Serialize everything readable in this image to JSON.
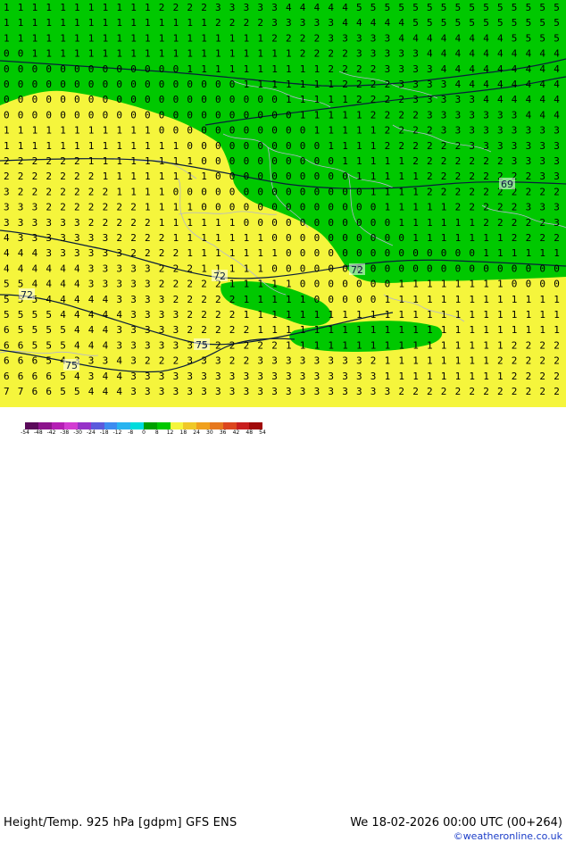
{
  "map": {
    "fields": {
      "green_color": "#00c800",
      "yellow_color": "#f5f53c",
      "border_color": "#b4b4d2",
      "contour_color": "#0a1e3c"
    },
    "contour_labels": [
      "69",
      "72",
      "72",
      "72",
      "75",
      "75"
    ],
    "grid_rows": [
      "1 1 1 1 1 1 1 1 1 1 1 2 2 2 2 3 3 3 3 3 4 4 4 4 4 5 5 5 5 5 5 5 5 5 5 5 5 5 5 5",
      "1 1 1 1 1 1 1 1 1 1 1 1 1 1 1 2 2 2 2 3 3 3 3 3 4 4 4 4 4 5 5 5 5 5 5 5 5 5 5 5",
      "1 1 1 1 1 1 1 1 1 1 1 1 1 1 1 1 1 1 1 2 2 2 2 3 3 3 3 3 4 4 4 4 4 4 4 4 5 5 5 5",
      "0 0 1 1 1 1 1 1 1 1 1 1 1 1 1 1 1 1 1 1 1 2 2 2 2 3 3 3 3 3 4 4 4 4 4 4 4 4 4 4",
      "0 0 0 0 0 0 0 0 0 0 0 0 0 1 1 1 1 1 1 1 1 1 1 2 2 2 2 3 3 3 3 4 4 4 4 4 4 4 4 4",
      "0 0 0 0 0 0 0 0 0 0 0 0 0 0 0 0 0 1 1 1 1 1 1 1 2 2 2 2 3 3 3 3 4 4 4 4 4 4 4 4",
      "0 0 0 0 0 0 0 0 0 0 0 0 0 0 0 0 0 0 0 0 1 1 1 1 1 2 2 2 2 3 3 3 3 3 4 4 4 4 4 4",
      "0 0 0 0 0 0 0 0 0 0 0 0 0 0 0 0 0 0 0 0 0 1 1 1 1 1 2 2 2 2 3 3 3 3 3 3 3 4 4 4",
      "1 1 1 1 1 1 1 1 1 1 1 0 0 0 0 0 0 0 0 0 0 0 1 1 1 1 1 2 2 2 2 3 3 3 3 3 3 3 3 3",
      "1 1 1 1 1 1 1 1 1 1 1 1 1 0 0 0 0 0 0 0 0 0 0 1 1 1 1 2 2 2 2 2 2 3 3 3 3 3 3 3",
      "2 2 2 2 2 2 1 1 1 1 1 1 1 1 0 0 0 0 0 0 0 0 0 0 1 1 1 1 1 2 2 2 2 2 2 2 3 3 3 3",
      "2 2 2 2 2 2 2 1 1 1 1 1 1 1 1 0 0 0 0 0 0 0 0 0 0 1 1 1 1 1 2 2 2 2 2 2 2 2 3 3",
      "3 2 2 2 2 2 2 2 1 1 1 1 0 0 0 0 0 0 0 0 0 0 0 0 0 0 1 1 1 1 2 2 2 2 2 2 2 2 2 2",
      "3 3 3 2 2 2 2 2 2 2 1 1 1 1 0 0 0 0 0 0 0 0 0 0 0 0 0 1 1 1 1 1 2 2 2 2 2 3 3 3",
      "3 3 3 3 3 3 2 2 2 2 2 1 1 1 1 1 1 0 0 0 0 0 0 0 0 0 0 0 1 1 1 1 1 1 2 2 2 2 2 3",
      "4 3 3 3 3 3 3 3 2 2 2 2 1 1 1 1 1 1 1 0 0 0 0 0 0 0 0 0 0 1 1 1 1 1 1 1 2 2 2 2",
      "4 4 4 3 3 3 3 3 3 2 2 2 2 1 1 1 1 1 1 1 0 0 0 0 0 0 0 0 0 0 0 0 0 0 1 1 1 1 1 1",
      "4 4 4 4 4 4 3 3 3 3 3 2 2 2 1 1 1 1 1 0 0 0 0 0 0 0 0 0 0 0 0 0 0 0 0 0 0 0 0 0",
      "5 5 4 4 4 4 3 3 3 3 3 2 2 2 2 2 1 1 1 1 1 0 0 0 0 0 0 0 1 1 1 1 1 1 1 1 0 0 0 0",
      "5 5 5 4 4 4 4 4 3 3 3 3 2 2 2 2 2 1 1 1 1 1 0 0 0 0 0 1 1 1 1 1 1 1 1 1 1 1 1 1",
      "5 5 5 5 4 4 4 4 4 3 3 3 3 2 2 2 2 1 1 1 1 1 1 1 1 1 1 1 1 1 1 1 1 1 1 1 1 1 1 1",
      "6 5 5 5 5 4 4 4 3 3 3 3 3 2 2 2 2 2 1 1 1 1 1 1 1 1 1 1 1 1 1 1 1 1 1 1 1 1 1 1",
      "6 6 5 5 5 4 4 4 3 3 3 3 3 3 3 2 2 2 2 2 1 1 1 1 1 1 1 1 1 1 1 1 1 1 1 1 2 2 2 2",
      "6 6 6 5 4 3 3 3 4 3 2 2 2 3 3 3 2 2 3 3 3 3 3 3 3 3 2 1 1 1 1 1 1 1 1 2 2 2 2 2",
      "6 6 6 6 5 4 3 4 4 3 3 3 3 3 3 3 3 3 3 3 3 3 3 3 3 3 3 1 1 1 1 1 1 1 1 1 2 2 2 2",
      "7 7 6 6 5 5 4 4 4 3 3 3 3 3 3 3 3 3 3 3 3 3 3 3 3 3 3 3 2 2 2 2 2 2 2 2 2 2 2 2"
    ]
  },
  "footer": {
    "title": "Height/Temp. 925 hPa [gdpm] GFS ENS",
    "datetime": "We 18-02-2026 00:00 UTC (00+264)",
    "credit": "©weatheronline.co.uk",
    "colorbar": {
      "labels": [
        "-54",
        "-48",
        "-42",
        "-38",
        "-30",
        "-24",
        "-18",
        "-12",
        "-8",
        "0",
        "8",
        "12",
        "18",
        "24",
        "30",
        "36",
        "42",
        "48",
        "54"
      ],
      "colors": [
        "#5a0a5a",
        "#8c148c",
        "#b41eb4",
        "#d23cd2",
        "#9632c8",
        "#5a5adc",
        "#3c8cf0",
        "#28b4f0",
        "#00dcdc",
        "#00a000",
        "#00c800",
        "#f5f53c",
        "#f0c828",
        "#f0a01e",
        "#e6781e",
        "#dc461e",
        "#c81e1e",
        "#a00a0a"
      ]
    }
  }
}
